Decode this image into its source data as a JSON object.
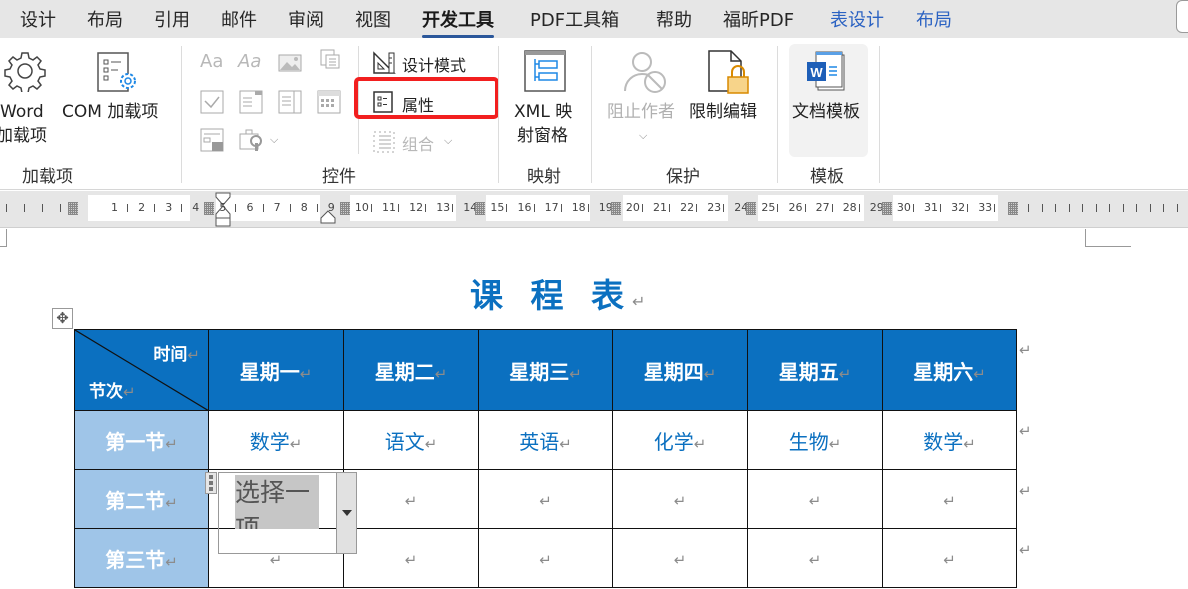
{
  "tabs": [
    {
      "label": "设计",
      "state": "normal"
    },
    {
      "label": "布局",
      "state": "normal"
    },
    {
      "label": "引用",
      "state": "normal"
    },
    {
      "label": "邮件",
      "state": "normal"
    },
    {
      "label": "审阅",
      "state": "normal"
    },
    {
      "label": "视图",
      "state": "normal"
    },
    {
      "label": "开发工具",
      "state": "active"
    },
    {
      "label": "PDF工具箱",
      "state": "normal"
    },
    {
      "label": "帮助",
      "state": "normal"
    },
    {
      "label": "福昕PDF",
      "state": "normal"
    },
    {
      "label": "表设计",
      "state": "contextual"
    },
    {
      "label": "布局",
      "state": "contextual"
    }
  ],
  "ribbon": {
    "addins": {
      "group_label": "加载项",
      "word_addins": {
        "line1": "Word",
        "line2": "加载项",
        "icon": "gear-icon"
      },
      "com_addins": {
        "label": "COM 加载项",
        "icon": "list-gear-icon"
      }
    },
    "controls": {
      "group_label": "控件",
      "icons": [
        "rich-text-control-icon",
        "plain-text-control-icon",
        "picture-control-icon",
        "building-block-control-icon",
        "checkbox-control-icon",
        "combo-box-control-icon",
        "dropdown-list-control-icon",
        "date-picker-control-icon",
        "repeating-section-icon",
        "legacy-tools-icon"
      ],
      "design_mode": "设计模式",
      "properties": "属性",
      "group": "组合"
    },
    "mapping": {
      "group_label": "映射",
      "xml_pane": {
        "line1": "XML 映",
        "line2": "射窗格"
      }
    },
    "protect": {
      "group_label": "保护",
      "block_authors": "阻止作者",
      "restrict_editing": "限制编辑"
    },
    "templates": {
      "group_label": "模板",
      "document_template": "文档模板"
    }
  },
  "ruler": {
    "numbers": [
      "1",
      "2",
      "3",
      "4",
      "5",
      "6",
      "7",
      "8",
      "9",
      "10",
      "11",
      "12",
      "13",
      "14",
      "15",
      "16",
      "17",
      "18",
      "19",
      "20",
      "21",
      "22",
      "23",
      "24",
      "25",
      "26",
      "27",
      "28",
      "29",
      "30",
      "31",
      "32",
      "33"
    ]
  },
  "document": {
    "title": "课 程 表",
    "paragraph_mark": "↵",
    "table": {
      "corner_top": "时间",
      "corner_bottom": "节次",
      "days": [
        "星期一",
        "星期二",
        "星期三",
        "星期四",
        "星期五",
        "星期六"
      ],
      "rows": [
        {
          "period": "第一节",
          "cells": [
            "数学",
            "语文",
            "英语",
            "化学",
            "生物",
            "数学"
          ]
        },
        {
          "period": "第二节",
          "cells": [
            "",
            "",
            "",
            "",
            "",
            ""
          ]
        },
        {
          "period": "第三节",
          "cells": [
            "",
            "",
            "",
            "",
            "",
            ""
          ]
        }
      ]
    },
    "dropdown_control": {
      "placeholder": "选择一项。"
    }
  },
  "colors": {
    "accent_blue": "#0b70c0",
    "row_header_blue": "#9fc5e8",
    "highlight_red": "#f21f1f",
    "active_tab_underline": "#2b579a"
  }
}
